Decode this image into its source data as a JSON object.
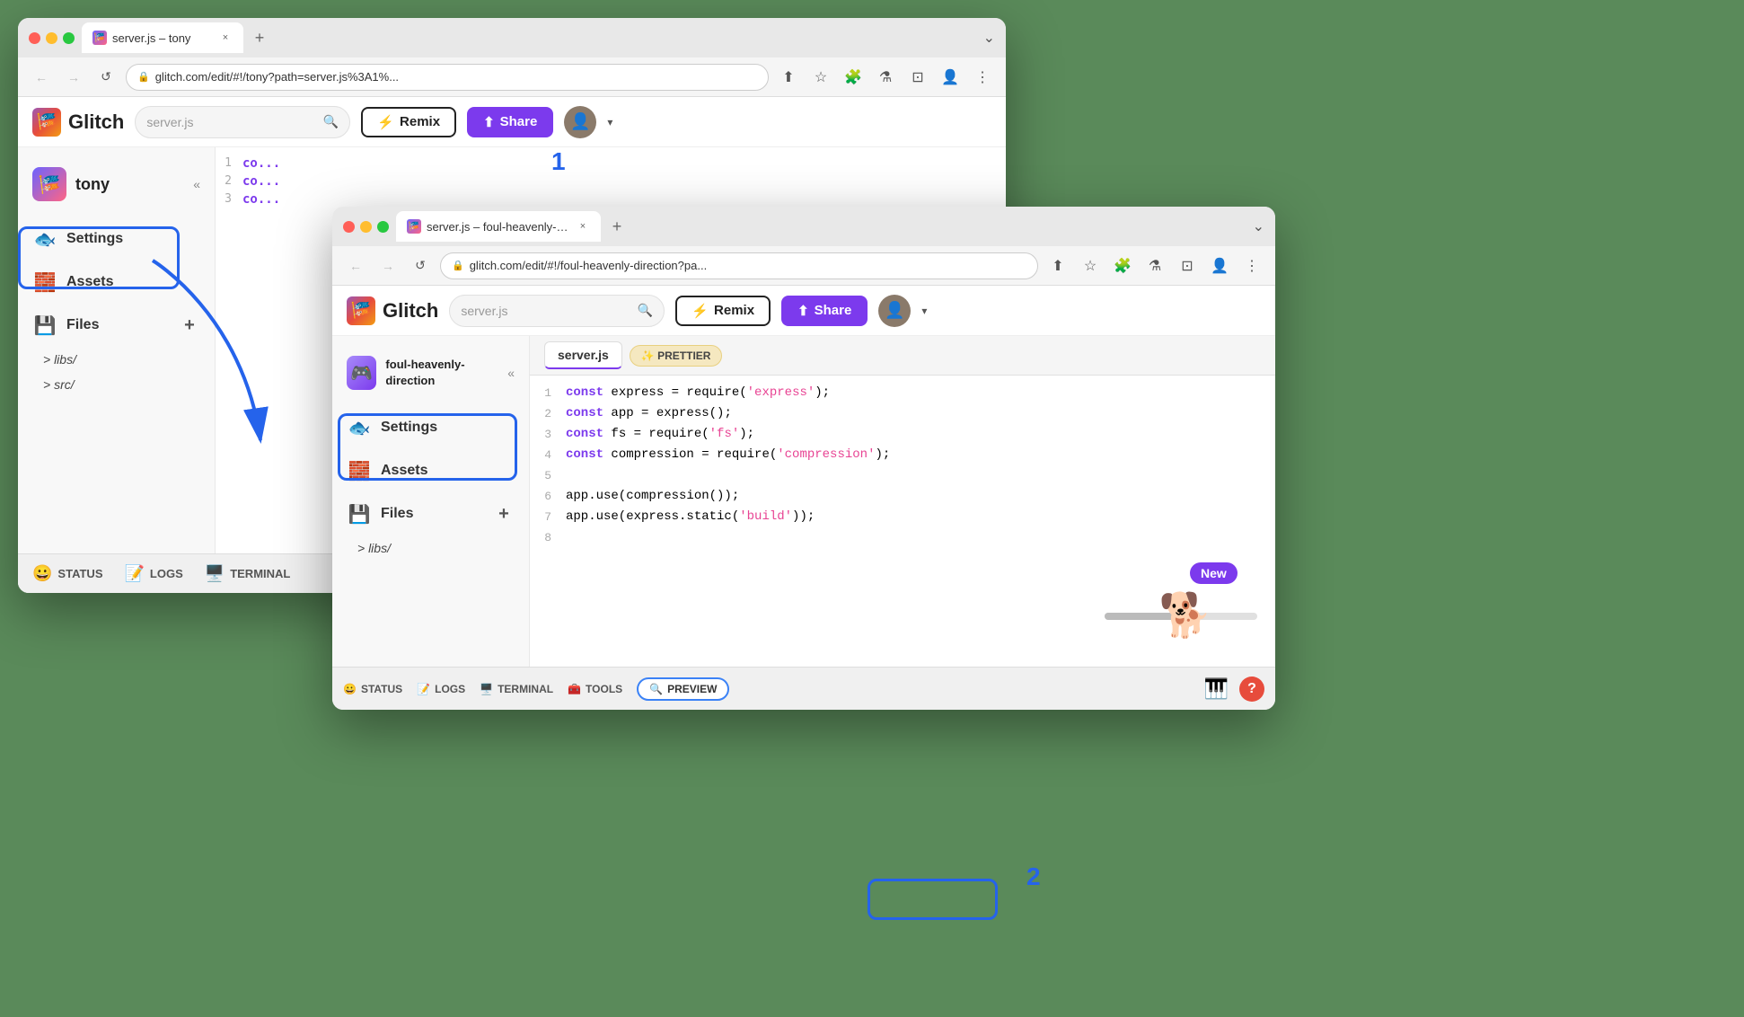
{
  "background_color": "#5a8a5a",
  "browser_back": {
    "tab": {
      "title": "server.js – tony",
      "favicon": "🎏"
    },
    "address": "glitch.com/edit/#!/tony?path=server.js%3A1%...",
    "header": {
      "logo": "Glitch",
      "search_placeholder": "server.js",
      "remix_label": "Remix",
      "share_label": "Share"
    },
    "sidebar": {
      "project_name": "tony",
      "collapse_label": "«",
      "items": [
        {
          "id": "settings",
          "label": "Settings",
          "icon": "🐟"
        },
        {
          "id": "assets",
          "label": "Assets",
          "icon": "🧱"
        },
        {
          "id": "files",
          "label": "Files",
          "icon": "💾"
        }
      ],
      "tree": [
        {
          "label": "> libs/"
        },
        {
          "label": "> src/"
        }
      ]
    },
    "status_bar": {
      "items": [
        {
          "id": "status",
          "label": "STATUS",
          "icon": "😀"
        },
        {
          "id": "logs",
          "label": "LOGS",
          "icon": "📝"
        },
        {
          "id": "terminal",
          "label": "TERMINAL",
          "icon": "🖥️"
        }
      ]
    },
    "code": {
      "lines": [
        {
          "num": "1",
          "content": "co..."
        },
        {
          "num": "2",
          "content": "co..."
        },
        {
          "num": "3",
          "content": "co..."
        }
      ]
    }
  },
  "browser_front": {
    "tab": {
      "title": "server.js – foul-heavenly-direc",
      "favicon": "🎏"
    },
    "address": "glitch.com/edit/#!/foul-heavenly-direction?pa...",
    "header": {
      "logo": "Glitch",
      "search_placeholder": "server.js",
      "remix_label": "Remix",
      "share_label": "Share"
    },
    "sidebar": {
      "project_name": "foul-heavenly-direction",
      "project_icon": "🎮",
      "collapse_label": "«",
      "items": [
        {
          "id": "settings",
          "label": "Settings",
          "icon": "🐟"
        },
        {
          "id": "assets",
          "label": "Assets",
          "icon": "🧱"
        },
        {
          "id": "files",
          "label": "Files",
          "icon": "💾"
        }
      ],
      "tree": [
        {
          "label": "> libs/"
        }
      ]
    },
    "code": {
      "active_tab": "server.js",
      "prettier_label": "✨ PRETTIER",
      "lines": [
        {
          "num": "1",
          "kw": "const",
          "rest": " express = require(",
          "str": "'express'",
          "end": ");"
        },
        {
          "num": "2",
          "kw": "const",
          "rest": " app = express();"
        },
        {
          "num": "3",
          "kw": "const",
          "rest": " fs = require(",
          "str": "'fs'",
          "end": ");"
        },
        {
          "num": "4",
          "kw": "const",
          "rest": " compression = require(",
          "str": "'compression'",
          "end": ");"
        },
        {
          "num": "5",
          "rest": ""
        },
        {
          "num": "6",
          "rest": "app.use(compression());"
        },
        {
          "num": "7",
          "rest": "app.use(express.static(",
          "str": "'build'",
          "end": "));"
        },
        {
          "num": "8",
          "rest": ""
        }
      ]
    },
    "status_bar": {
      "items": [
        {
          "id": "status",
          "label": "STATUS",
          "icon": "😀"
        },
        {
          "id": "logs",
          "label": "LOGS",
          "icon": "📝"
        },
        {
          "id": "terminal",
          "label": "TERMINAL",
          "icon": "🖥️"
        },
        {
          "id": "tools",
          "label": "TOOLS",
          "icon": "🧰"
        },
        {
          "id": "preview",
          "label": "PREVIEW",
          "icon": "🔍"
        }
      ],
      "piano_icon": "🎹",
      "help_label": "?"
    },
    "new_badge": "New",
    "arrow_annotation": {
      "number1": "1",
      "number2": "2"
    }
  }
}
